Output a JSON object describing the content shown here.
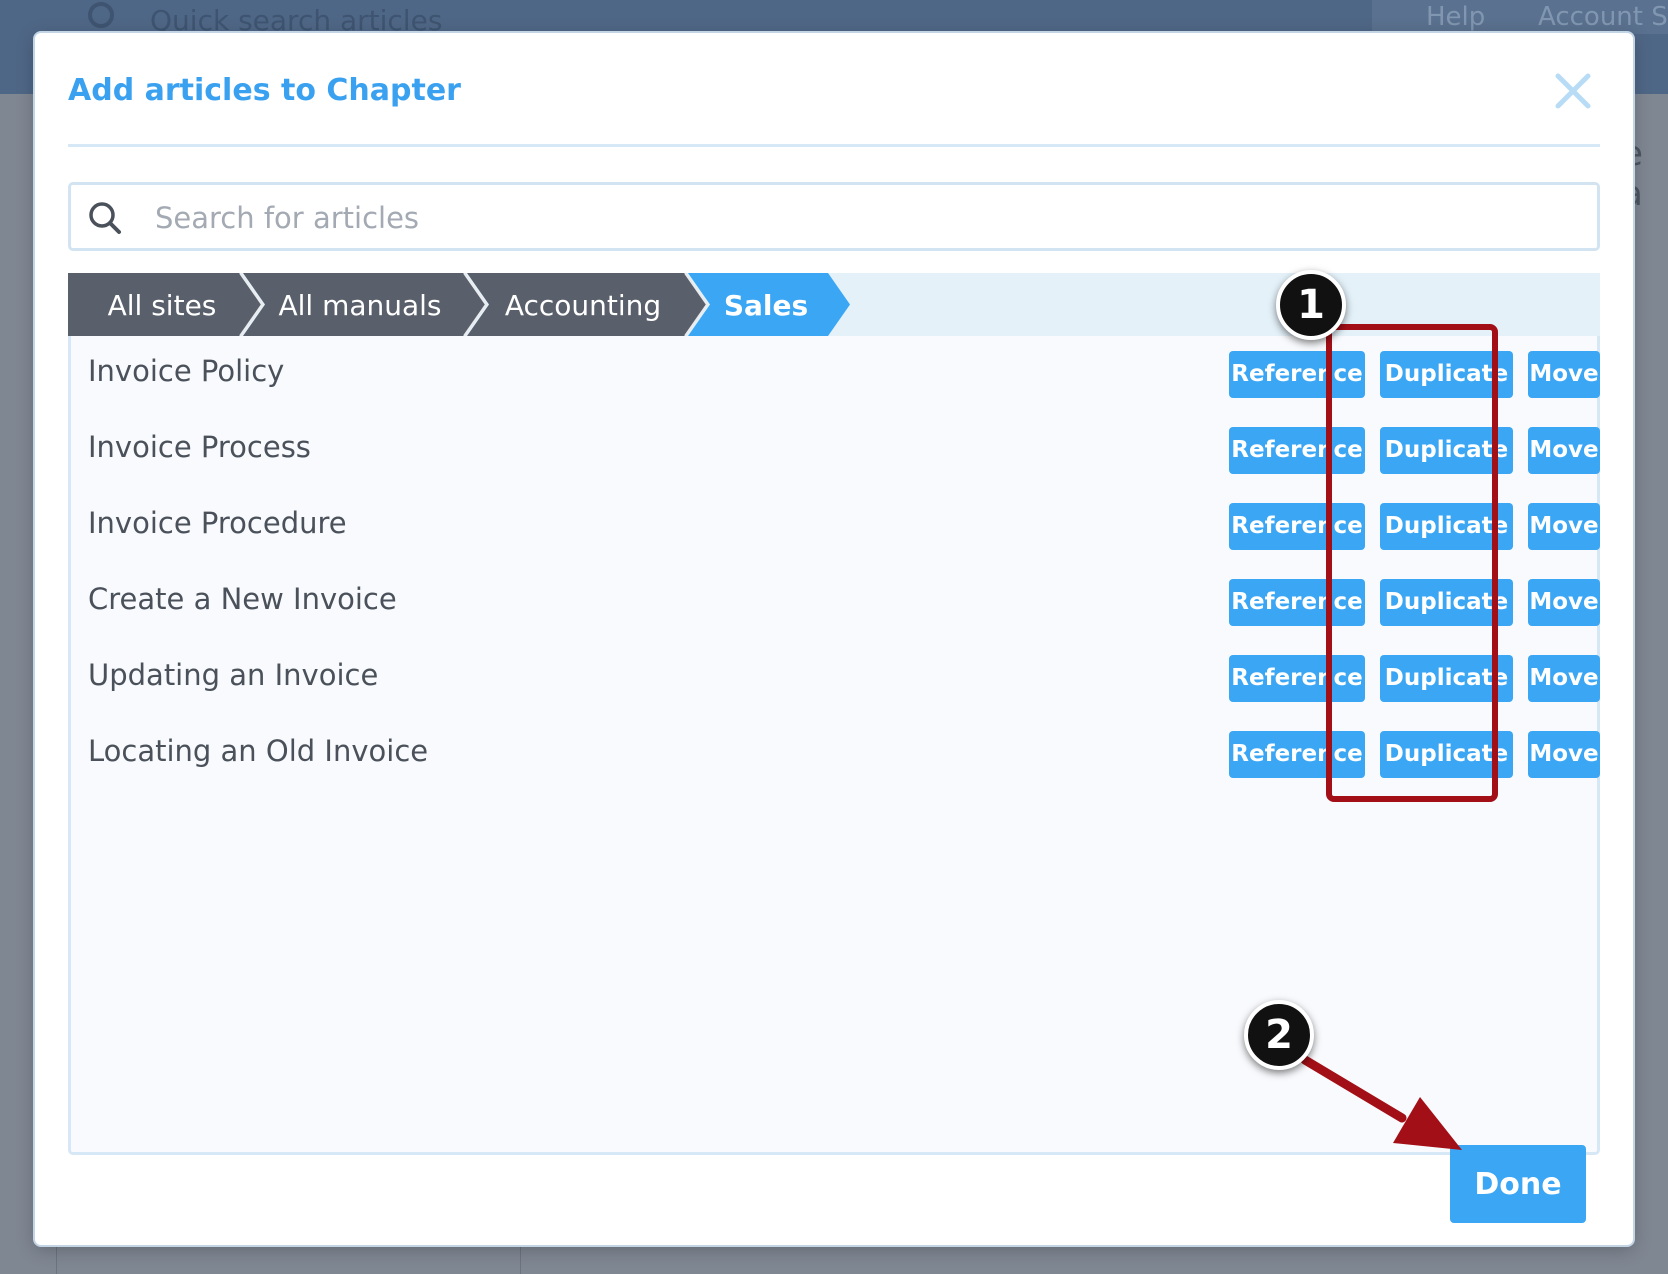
{
  "background": {
    "search_placeholder": "Quick search articles",
    "help_label": "Help",
    "account_label": "Account Se",
    "partial_text": "e a"
  },
  "modal": {
    "title": "Add articles to Chapter",
    "search_placeholder": "Search for articles",
    "breadcrumbs": [
      "All sites",
      "All manuals",
      "Accounting",
      "Sales"
    ],
    "articles": [
      {
        "title": "Invoice Policy"
      },
      {
        "title": "Invoice Process"
      },
      {
        "title": "Invoice Procedure"
      },
      {
        "title": "Create a New Invoice"
      },
      {
        "title": "Updating an Invoice"
      },
      {
        "title": "Locating an Old Invoice"
      }
    ],
    "buttons": {
      "reference": "Reference",
      "duplicate": "Duplicate",
      "move": "Move"
    },
    "done_label": "Done"
  },
  "annotations": {
    "step1": "1",
    "step2": "2"
  },
  "colors": {
    "accent": "#3aa6f4",
    "breadcrumb_dark": "#5a606b",
    "annotation_red": "#a30f17"
  }
}
